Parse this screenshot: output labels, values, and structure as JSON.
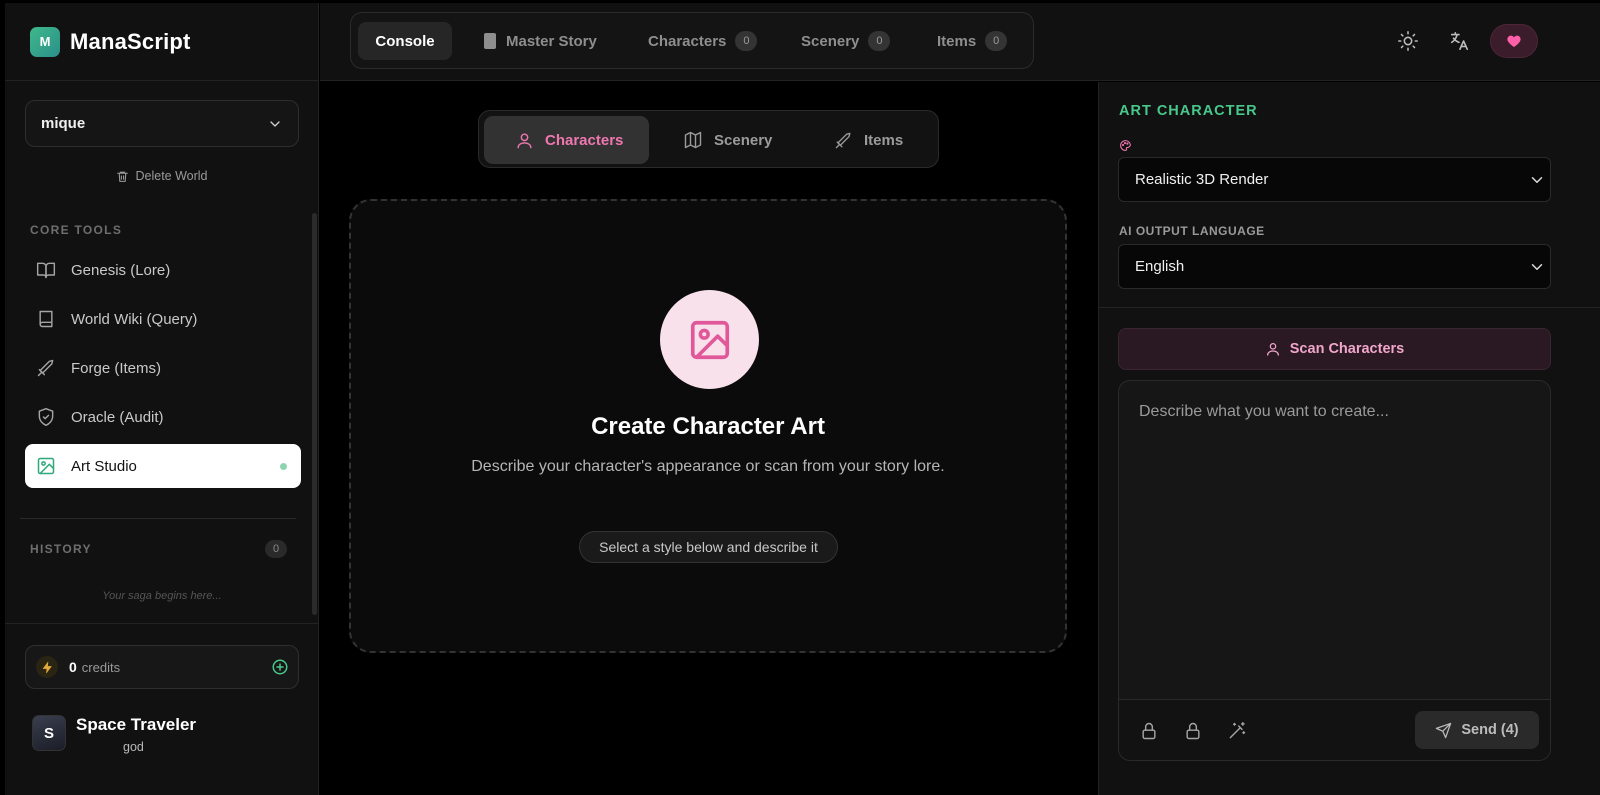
{
  "brand": {
    "logo_letter": "M",
    "name": "ManaScript"
  },
  "world": {
    "selected": "mique",
    "delete_label": "Delete World"
  },
  "sidebar": {
    "core_tools_label": "CORE TOOLS",
    "items": [
      {
        "label": "Genesis (Lore)",
        "icon": "book-open-icon"
      },
      {
        "label": "World Wiki (Query)",
        "icon": "book-icon"
      },
      {
        "label": "Forge (Items)",
        "icon": "sword-icon"
      },
      {
        "label": "Oracle (Audit)",
        "icon": "shield-check-icon"
      },
      {
        "label": "Art Studio",
        "icon": "image-icon",
        "active": true
      }
    ],
    "history_label": "HISTORY",
    "history_count": "0",
    "history_empty": "Your saga begins here..."
  },
  "credits": {
    "value": "0",
    "label": "credits"
  },
  "user": {
    "initial": "S",
    "name": "Space Traveler",
    "role": "god"
  },
  "header": {
    "tabs": [
      {
        "label": "Console",
        "active": true
      },
      {
        "label": "Master Story"
      },
      {
        "label": "Characters",
        "count": "0"
      },
      {
        "label": "Scenery",
        "count": "0"
      },
      {
        "label": "Items",
        "count": "0"
      }
    ]
  },
  "main": {
    "tabs": [
      {
        "label": "Characters",
        "active": true
      },
      {
        "label": "Scenery"
      },
      {
        "label": "Items"
      }
    ],
    "empty_title": "Create Character Art",
    "empty_desc": "Describe your character's appearance or scan from your story lore.",
    "hint": "Select a style below and describe it"
  },
  "panel": {
    "title": "ART CHARACTER",
    "style_value": "Realistic 3D Render",
    "language_label": "AI OUTPUT LANGUAGE",
    "language_value": "English",
    "scan_label": "Scan Characters",
    "prompt_placeholder": "Describe what you want to create...",
    "send_label": "Send (4)"
  },
  "colors": {
    "accent_green": "#49c88b",
    "accent_pink": "#ee77b0",
    "background": "#000000",
    "surface": "#111111"
  }
}
